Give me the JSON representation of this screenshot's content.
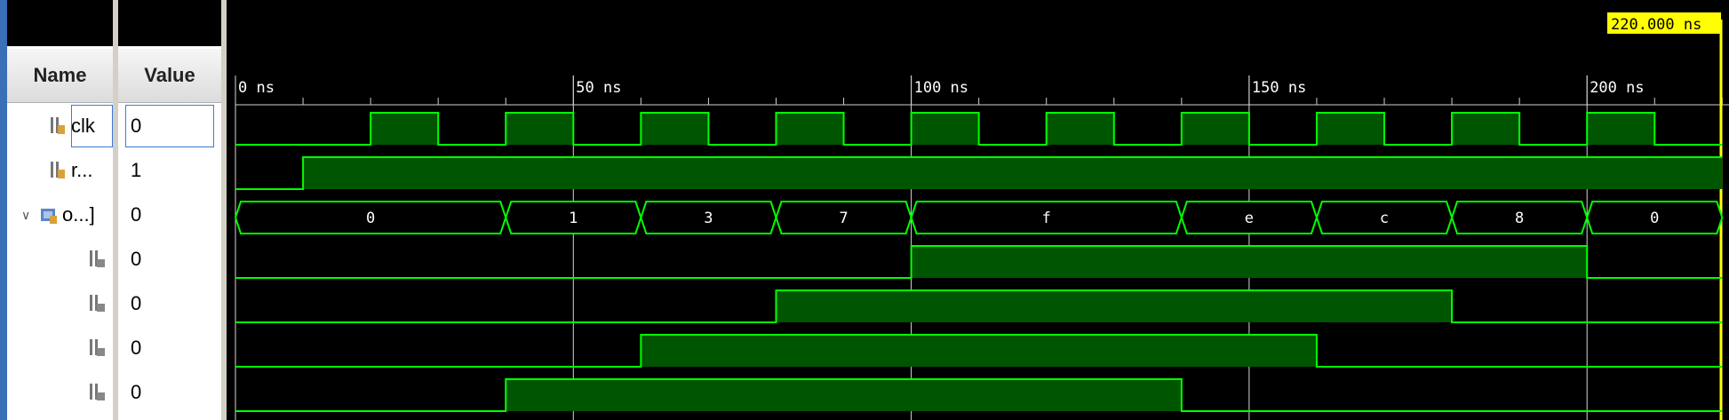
{
  "header": {
    "name_label": "Name",
    "value_label": "Value"
  },
  "cursor": {
    "time": 220,
    "label": "220.000 ns"
  },
  "timeline": {
    "max_ns": 220,
    "ticks": [
      {
        "t": 0,
        "label": "0 ns"
      },
      {
        "t": 50,
        "label": "50 ns"
      },
      {
        "t": 100,
        "label": "100 ns"
      },
      {
        "t": 150,
        "label": "150 ns"
      },
      {
        "t": 200,
        "label": "200 ns"
      }
    ]
  },
  "signals": [
    {
      "name": "clk",
      "value": "0",
      "kind": "bit",
      "icon": "signal-bit-icon",
      "transitions": [
        [
          0,
          0
        ],
        [
          20,
          1
        ],
        [
          30,
          0
        ],
        [
          40,
          1
        ],
        [
          50,
          0
        ],
        [
          60,
          1
        ],
        [
          70,
          0
        ],
        [
          80,
          1
        ],
        [
          90,
          0
        ],
        [
          100,
          1
        ],
        [
          110,
          0
        ],
        [
          120,
          1
        ],
        [
          130,
          0
        ],
        [
          140,
          1
        ],
        [
          150,
          0
        ],
        [
          160,
          1
        ],
        [
          170,
          0
        ],
        [
          180,
          1
        ],
        [
          190,
          0
        ],
        [
          200,
          1
        ],
        [
          210,
          0
        ]
      ]
    },
    {
      "name": "r...",
      "value": "1",
      "kind": "bit",
      "icon": "signal-bit-icon",
      "transitions": [
        [
          0,
          0
        ],
        [
          10,
          1
        ]
      ]
    },
    {
      "name": "o...]",
      "value": "0",
      "kind": "bus",
      "icon": "signal-bus-icon",
      "expanded": true,
      "segments": [
        [
          0,
          40,
          "0"
        ],
        [
          40,
          60,
          "1"
        ],
        [
          60,
          80,
          "3"
        ],
        [
          80,
          100,
          "7"
        ],
        [
          100,
          140,
          "f"
        ],
        [
          140,
          160,
          "e"
        ],
        [
          160,
          180,
          "c"
        ],
        [
          180,
          200,
          "8"
        ],
        [
          200,
          220,
          "0"
        ]
      ]
    },
    {
      "name": "",
      "value": "0",
      "kind": "bit",
      "icon": "signal-sub-bit-icon",
      "transitions": [
        [
          0,
          0
        ],
        [
          100,
          1
        ],
        [
          200,
          0
        ]
      ]
    },
    {
      "name": "",
      "value": "0",
      "kind": "bit",
      "icon": "signal-sub-bit-icon",
      "transitions": [
        [
          0,
          0
        ],
        [
          80,
          1
        ],
        [
          180,
          0
        ]
      ]
    },
    {
      "name": "",
      "value": "0",
      "kind": "bit",
      "icon": "signal-sub-bit-icon",
      "transitions": [
        [
          0,
          0
        ],
        [
          60,
          1
        ],
        [
          160,
          0
        ]
      ]
    },
    {
      "name": "",
      "value": "0",
      "kind": "bit",
      "icon": "signal-sub-bit-icon",
      "transitions": [
        [
          0,
          0
        ],
        [
          40,
          1
        ],
        [
          140,
          0
        ]
      ]
    }
  ],
  "colors": {
    "wave": "#00ff00",
    "fill": "#005500",
    "cursor": "#ffff00",
    "tick": "#ffffff"
  }
}
